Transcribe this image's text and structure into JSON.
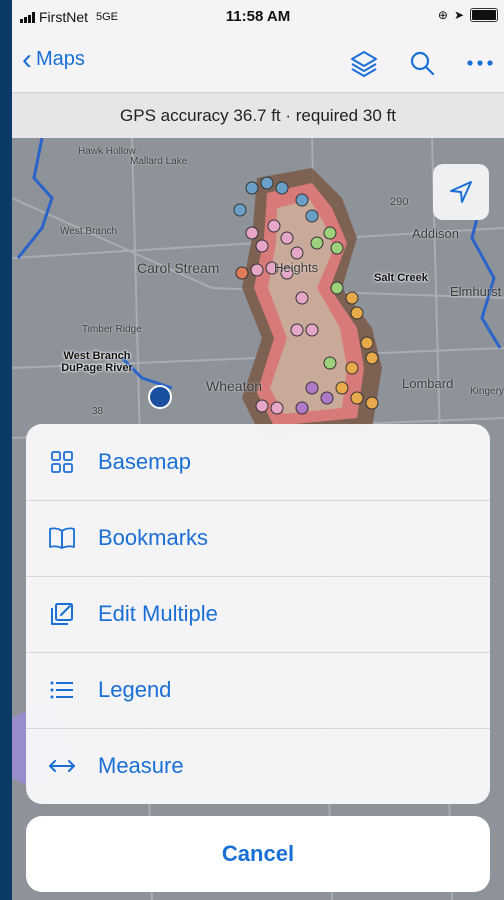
{
  "status_bar": {
    "carrier": "FirstNet",
    "network": "5GE",
    "time": "11:58 AM"
  },
  "nav": {
    "back_label": "Maps"
  },
  "gps": {
    "text": "GPS accuracy 36.7 ft · required 30 ft"
  },
  "map": {
    "labels": [
      "Hawk Hollow",
      "Mallard Lake",
      "West Branch",
      "Carol Stream",
      "Heights",
      "Timber Ridge",
      "Wheaton",
      "Addison",
      "Elmhurst",
      "Lombard",
      "290",
      "38",
      "Kingery"
    ],
    "feature_labels": [
      "Salt Creek",
      "West Branch DuPage River"
    ]
  },
  "menu": {
    "items": [
      {
        "label": "Basemap",
        "icon": "grid-icon"
      },
      {
        "label": "Bookmarks",
        "icon": "book-icon"
      },
      {
        "label": "Edit Multiple",
        "icon": "edit-multiple-icon"
      },
      {
        "label": "Legend",
        "icon": "list-icon"
      },
      {
        "label": "Measure",
        "icon": "measure-arrows-icon"
      }
    ],
    "cancel_label": "Cancel"
  },
  "colors": {
    "accent": "#1a6fd6",
    "frame": "#0b3a66"
  }
}
